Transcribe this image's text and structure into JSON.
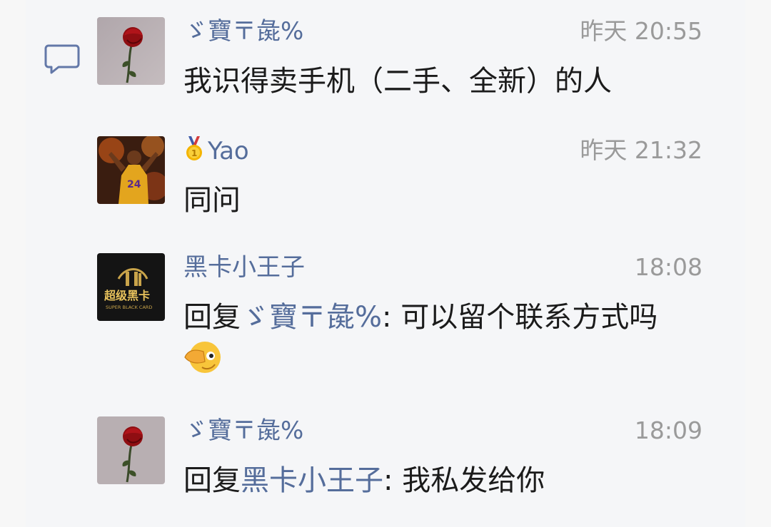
{
  "comments": [
    {
      "name": "ゞ寶〒彘%",
      "time": "昨天 20:55",
      "text": "我识得卖手机（二手、全新）的人"
    },
    {
      "name": "Yao",
      "time": "昨天 21:32",
      "text": "同问"
    },
    {
      "name": "黑卡小王子",
      "time": "18:08",
      "reply_prefix": "回复",
      "reply_to": "ゞ寶〒彘%",
      "reply_text": ": 可以留个联系方式吗",
      "avatar_text": "超级黑卡",
      "avatar_subtext": "SUPER BLACK CARD"
    },
    {
      "name": "ゞ寶〒彘%",
      "time": "18:09",
      "reply_prefix": "回复",
      "reply_to": "黑卡小王子",
      "reply_text": ": 我私发给你"
    }
  ],
  "colors": {
    "name": "#556d9b",
    "time": "#9a9a9a",
    "text": "#1b1b1b",
    "background": "#f5f6f8"
  },
  "icons": [
    "comment-icon",
    "medal-icon",
    "facepalm-emoji"
  ]
}
